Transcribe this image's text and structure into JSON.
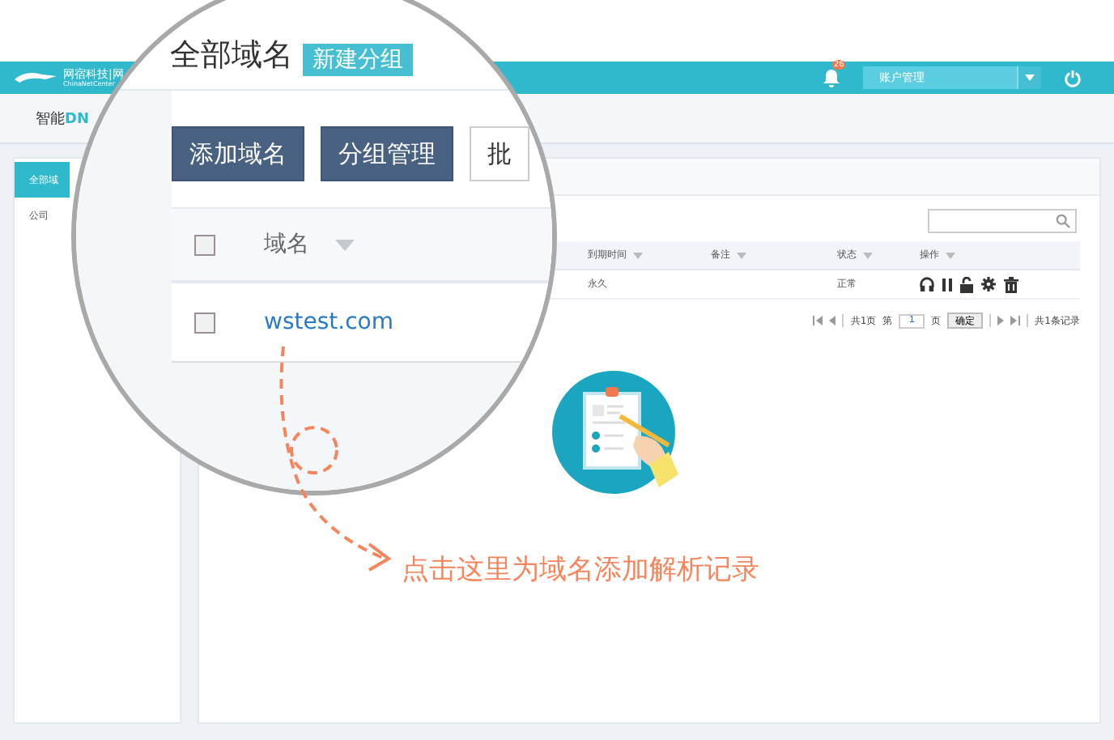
{
  "header": {
    "logo": "网宿科技|网",
    "logo_subtitle": "ChinaNetCenter",
    "notification_count": "26",
    "account_menu": "账户管理"
  },
  "page_title": {
    "prefix": "智能",
    "suffix": "DN"
  },
  "sidebar": {
    "items": [
      {
        "label": "全部域",
        "selected": true
      },
      {
        "label": "公司",
        "selected": false
      }
    ]
  },
  "table": {
    "columns": [
      {
        "label": "到期时间"
      },
      {
        "label": "备注"
      },
      {
        "label": "状态"
      },
      {
        "label": "操作"
      }
    ],
    "rows": [
      {
        "expiry": "永久",
        "status": "正常"
      }
    ]
  },
  "pagination": {
    "page_count": "共1页",
    "page_before": "第",
    "page_input": "1",
    "page_after": "页",
    "confirm": "确定",
    "total": "共1条记录"
  },
  "magnifier": {
    "heading": "全部域名",
    "new_group": "新建分组",
    "buttons": [
      {
        "label": "添加域名",
        "kind": "primary"
      },
      {
        "label": "分组管理",
        "kind": "primary"
      },
      {
        "label": "批",
        "kind": "plain"
      }
    ],
    "header_checked": false,
    "column": "域名",
    "rows": [
      {
        "domain": "wstest.com",
        "checked": false
      }
    ]
  },
  "annotation": "点击这里为域名添加解析记录"
}
